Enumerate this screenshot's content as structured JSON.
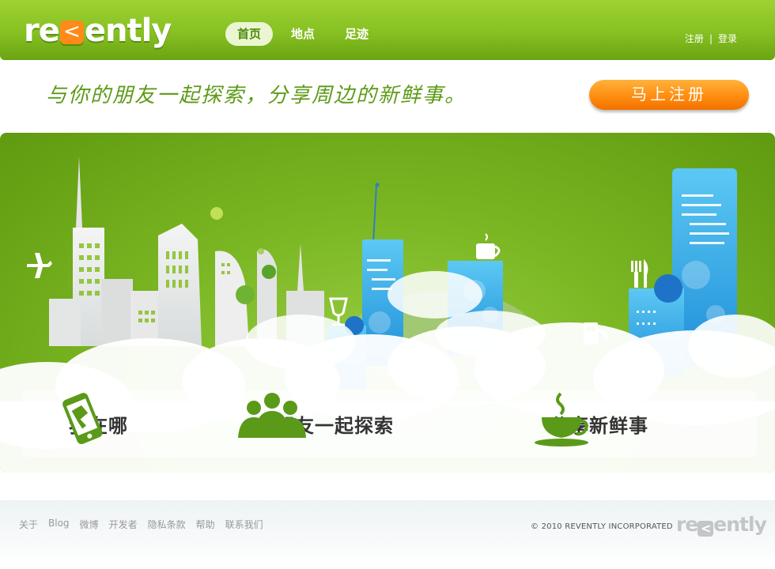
{
  "header": {
    "logo_text_start": "re",
    "logo_bubble_glyph": "<",
    "logo_text_end": "ently",
    "nav": [
      {
        "label": "首页",
        "active": true
      },
      {
        "label": "地点",
        "active": false
      },
      {
        "label": "足迹",
        "active": false
      }
    ],
    "auth": {
      "register": "注册",
      "separator": "|",
      "login": "登录"
    }
  },
  "tagline": "与你的朋友一起探索，分享周边的新鲜事。",
  "signup_button": "马上注册",
  "features": [
    {
      "icon": "phone-map-icon",
      "label": "我在哪"
    },
    {
      "icon": "friends-group-icon",
      "label": "与朋友一起探索"
    },
    {
      "icon": "coffee-cup-icon",
      "label": "分享新鲜事"
    }
  ],
  "footer": {
    "links": [
      "关于",
      "Blog",
      "微博",
      "开发者",
      "隐私条款",
      "帮助",
      "联系我们"
    ],
    "copyright": "© 2010 REVENTLY INCORPORATED",
    "logo_text_start": "re",
    "logo_bubble_glyph": "<",
    "logo_text_end": "ently"
  },
  "colors": {
    "header_green": "#86c022",
    "tagline_green": "#5d9a17",
    "signup_orange": "#ff8a0c",
    "building_blue": "#3aaee8",
    "icon_green": "#5a9a18"
  }
}
